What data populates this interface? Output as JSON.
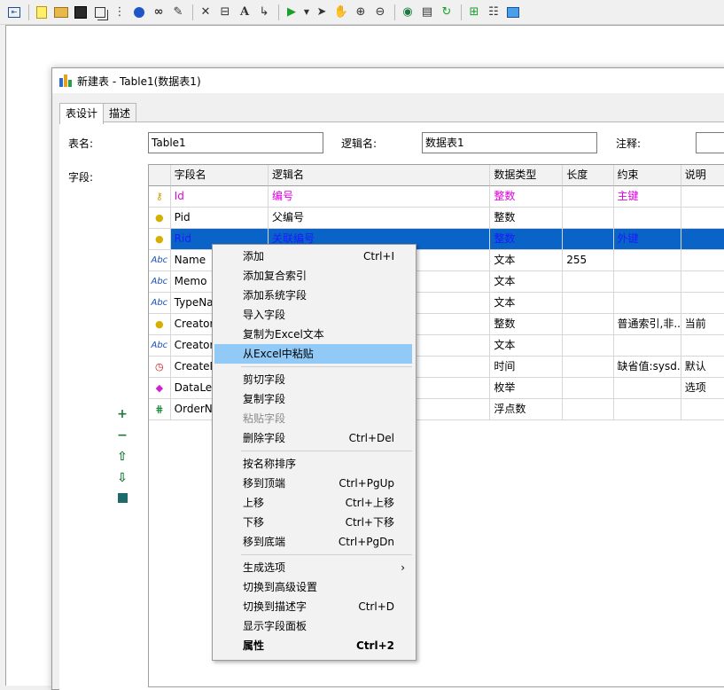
{
  "toolbar": {
    "buttons": [
      "nav-back-icon",
      "new-file-icon",
      "open-folder-icon",
      "save-icon",
      "copy-icon",
      "hierarchy-icon",
      "globe-icon",
      "binoculars-icon",
      "pencil-icon",
      "delete-x-icon",
      "box-icon",
      "text-a-icon",
      "connector-icon",
      "play-icon",
      "dropdown-icon",
      "pointer-icon",
      "hand-icon",
      "zoom-in-icon",
      "zoom-out-icon",
      "eye-icon",
      "report-icon",
      "refresh-icon",
      "add-tree-icon",
      "properties-icon",
      "image-icon"
    ]
  },
  "window": {
    "title": "新建表 - Table1(数据表1)",
    "tabs": [
      "表设计",
      "描述"
    ]
  },
  "form": {
    "table_name_label": "表名:",
    "table_name_value": "Table1",
    "logical_name_label": "逻辑名:",
    "logical_name_value": "数据表1",
    "comment_label": "注释:",
    "comment_value": "",
    "fields_label": "字段:"
  },
  "grid": {
    "headers": [
      "字段名",
      "逻辑名",
      "数据类型",
      "长度",
      "约束",
      "说明"
    ],
    "rows": [
      {
        "icon": "key-icon",
        "name": "Id",
        "logical": "编号",
        "type": "整数",
        "length": "",
        "constraint": "主键",
        "desc": ""
      },
      {
        "icon": "index-bulb-icon",
        "name": "Pid",
        "logical": "父编号",
        "type": "整数",
        "length": "",
        "constraint": "",
        "desc": ""
      },
      {
        "icon": "index-bulb-icon",
        "name": "Rid",
        "logical": "关联编号",
        "type": "整数",
        "length": "",
        "constraint": "外键",
        "desc": ""
      },
      {
        "icon": "text-abc-icon",
        "name": "Name",
        "logical": "",
        "type": "文本",
        "length": "255",
        "constraint": "",
        "desc": ""
      },
      {
        "icon": "text-abc-icon",
        "name": "Memo",
        "logical": "",
        "type": "文本",
        "length": "",
        "constraint": "",
        "desc": ""
      },
      {
        "icon": "text-abc-icon",
        "name": "TypeNa",
        "logical": "",
        "type": "文本",
        "length": "",
        "constraint": "",
        "desc": ""
      },
      {
        "icon": "index-bulb-icon",
        "name": "Creator",
        "logical": "",
        "type": "整数",
        "length": "",
        "constraint": "普通索引,非...",
        "desc": "当前"
      },
      {
        "icon": "text-abc-icon",
        "name": "Creator",
        "logical": "",
        "type": "文本",
        "length": "",
        "constraint": "",
        "desc": ""
      },
      {
        "icon": "clock-icon",
        "name": "CreateD",
        "logical": "",
        "type": "时间",
        "length": "",
        "constraint": "缺省值:sysd...",
        "desc": "默认"
      },
      {
        "icon": "enum-diamond-icon",
        "name": "DataLev",
        "logical": "",
        "type": "枚举",
        "length": "",
        "constraint": "",
        "desc": "选项"
      },
      {
        "icon": "float-icon",
        "name": "OrderN",
        "logical": "",
        "type": "浮点数",
        "length": "",
        "constraint": "",
        "desc": ""
      }
    ]
  },
  "side_buttons": [
    "add-icon",
    "remove-icon",
    "move-up-icon",
    "move-down-icon",
    "stop-square-icon"
  ],
  "context_menu": {
    "items": [
      {
        "label": "添加",
        "shortcut": "Ctrl+I"
      },
      {
        "label": "添加复合索引",
        "shortcut": ""
      },
      {
        "label": "添加系统字段",
        "shortcut": ""
      },
      {
        "label": "导入字段",
        "shortcut": ""
      },
      {
        "label": "复制为Excel文本",
        "shortcut": ""
      },
      {
        "label": "从Excel中粘贴",
        "shortcut": ""
      },
      {
        "label": "剪切字段",
        "shortcut": ""
      },
      {
        "label": "复制字段",
        "shortcut": ""
      },
      {
        "label": "粘贴字段",
        "shortcut": ""
      },
      {
        "label": "删除字段",
        "shortcut": "Ctrl+Del"
      },
      {
        "label": "按名称排序",
        "shortcut": ""
      },
      {
        "label": "移到顶端",
        "shortcut": "Ctrl+PgUp"
      },
      {
        "label": "上移",
        "shortcut": "Ctrl+上移"
      },
      {
        "label": "下移",
        "shortcut": "Ctrl+下移"
      },
      {
        "label": "移到底端",
        "shortcut": "Ctrl+PgDn"
      },
      {
        "label": "生成选项",
        "shortcut": ""
      },
      {
        "label": "切换到高级设置",
        "shortcut": ""
      },
      {
        "label": "切换到描述字",
        "shortcut": "Ctrl+D"
      },
      {
        "label": "显示字段面板",
        "shortcut": ""
      },
      {
        "label": "属性",
        "shortcut": "Ctrl+2"
      }
    ]
  },
  "colors": {
    "selected_row_bg": "#0a64c8",
    "menu_highlight": "#91c9f7",
    "pink_text": "#e000e0"
  }
}
